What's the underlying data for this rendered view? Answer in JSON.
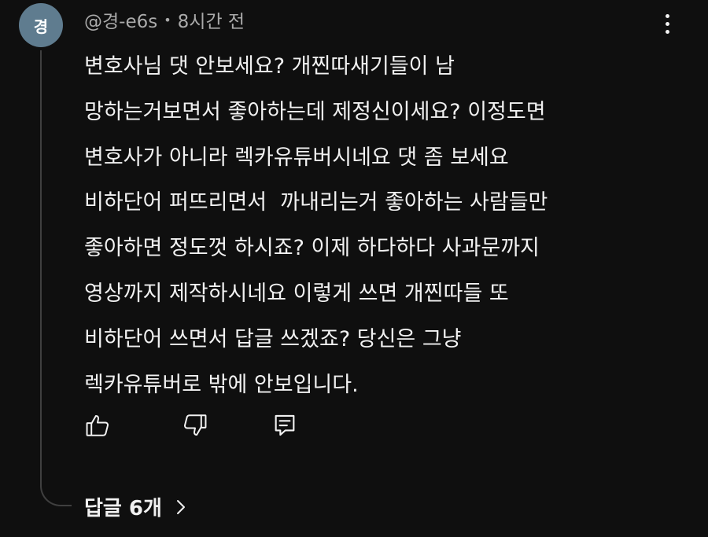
{
  "comment": {
    "avatar_text": "경",
    "avatar_color": "#5f7c8f",
    "author": "@경-e6s",
    "separator": "•",
    "time": "8시간 전",
    "lines": [
      "변호사님 댓 안보세요? 개찐따새기들이 남",
      "망하는거보면서 좋아하는데 제정신이세요? 이정도면",
      "변호사가 아니라 렉카유튜버시네요 댓 좀 보세요",
      "비하단어 퍼뜨리면서  까내리는거 좋아하는 사람들만",
      "좋아하면 정도껏 하시죠? 이제 하다하다 사과문까지",
      "영상까지 제작하시네요 이렇게 쓰면 개찐따들 또",
      "비하단어 쓰면서 답글 쓰겠죠? 당신은 그냥",
      "렉카유튜버로 밖에 안보입니다."
    ]
  },
  "actions": {
    "like_icon": "thumbs-up-icon",
    "dislike_icon": "thumbs-down-icon",
    "reply_icon": "reply-comment-icon",
    "menu_icon": "more-vertical-icon"
  },
  "replies": {
    "label": "답글 6개",
    "chevron_icon": "chevron-right-icon"
  }
}
